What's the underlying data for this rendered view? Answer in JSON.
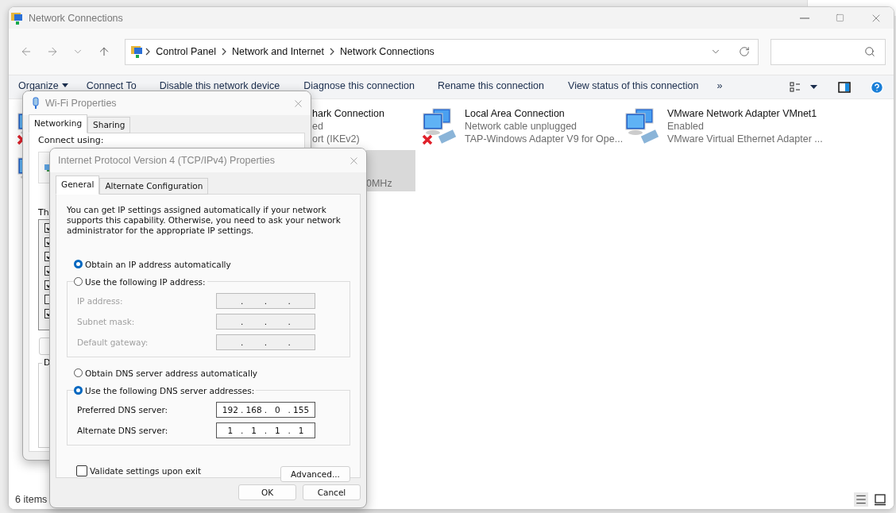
{
  "window": {
    "title": "Network Connections"
  },
  "address_bar": {
    "path": [
      "Control Panel",
      "Network and Internet",
      "Network Connections"
    ]
  },
  "command_bar": {
    "items": [
      {
        "label": "Organize",
        "kind": "menu"
      },
      {
        "label": "Connect To",
        "kind": "plain"
      },
      {
        "label": "Disable this network device",
        "kind": "plain"
      },
      {
        "label": "Diagnose this connection",
        "kind": "plain"
      },
      {
        "label": "Rename this connection",
        "kind": "plain"
      },
      {
        "label": "View status of this connection",
        "kind": "plain"
      }
    ],
    "overflow": "»"
  },
  "edge_icons": [
    {
      "disconnected": true
    },
    {
      "disconnected": false
    }
  ],
  "connections": [
    {
      "kind": "partial",
      "lines": [
        "hark Connection",
        "ed",
        "ort (IKEv2)"
      ],
      "selected": false
    },
    {
      "kind": "partial",
      "lines": [
        "0MHz"
      ],
      "selected": true
    },
    {
      "kind": "full",
      "lines": [
        "Local Area Connection",
        "Network cable unplugged",
        "TAP-Windows Adapter V9 for Ope..."
      ],
      "selected": false,
      "disconnected": true
    },
    {
      "kind": "full",
      "lines": [
        "VMware Network Adapter VMnet1",
        "Enabled",
        "VMware Virtual Ethernet Adapter ..."
      ],
      "selected": false,
      "disconnected": false
    }
  ],
  "wifi_properties": {
    "title": "Wi-Fi Properties",
    "tabs": [
      {
        "label": "Networking",
        "selected": true
      },
      {
        "label": "Sharing",
        "selected": false
      }
    ],
    "connect_label": "Connect using:",
    "list_label": "Th",
    "components": [
      {
        "checked": true
      },
      {
        "checked": true
      },
      {
        "checked": true
      },
      {
        "checked": true
      },
      {
        "checked": true
      },
      {
        "checked": false
      },
      {
        "checked": true
      }
    ],
    "group_label": "D"
  },
  "ipv4_properties": {
    "title": "Internet Protocol Version 4 (TCP/IPv4) Properties",
    "tabs": [
      {
        "label": "General",
        "selected": true
      },
      {
        "label": "Alternate Configuration",
        "selected": false
      }
    ],
    "intro": "You can get IP settings assigned automatically if your network supports this capability. Otherwise, you need to ask your network administrator for the appropriate IP settings.",
    "ip_auto": {
      "label": "Obtain an IP address automatically",
      "selected": true
    },
    "ip_manual": {
      "label": "Use the following IP address:",
      "selected": false
    },
    "ip_fields": [
      {
        "label": "IP address:",
        "disabled": true,
        "segments": [
          {
            "kind": "dot",
            "text": "."
          },
          {
            "kind": "dot",
            "text": "."
          },
          {
            "kind": "dot",
            "text": "."
          }
        ]
      },
      {
        "label": "Subnet mask:",
        "disabled": true,
        "segments": [
          {
            "kind": "dot",
            "text": "."
          },
          {
            "kind": "dot",
            "text": "."
          },
          {
            "kind": "dot",
            "text": "."
          }
        ]
      },
      {
        "label": "Default gateway:",
        "disabled": true,
        "segments": [
          {
            "kind": "dot",
            "text": "."
          },
          {
            "kind": "dot",
            "text": "."
          },
          {
            "kind": "dot",
            "text": "."
          }
        ]
      }
    ],
    "dns_auto": {
      "label": "Obtain DNS server address automatically",
      "selected": false
    },
    "dns_manual": {
      "label": "Use the following DNS server addresses:",
      "selected": true
    },
    "dns_fields": [
      {
        "label": "Preferred DNS server:",
        "disabled": false,
        "segments": [
          {
            "kind": "octet",
            "text": "192"
          },
          {
            "kind": "dot",
            "text": "."
          },
          {
            "kind": "octet",
            "text": "168"
          },
          {
            "kind": "dot",
            "text": "."
          },
          {
            "kind": "octet",
            "text": "0"
          },
          {
            "kind": "dot",
            "text": "."
          },
          {
            "kind": "octet",
            "text": "155"
          }
        ]
      },
      {
        "label": "Alternate DNS server:",
        "disabled": false,
        "segments": [
          {
            "kind": "octet",
            "text": "1"
          },
          {
            "kind": "dot",
            "text": "."
          },
          {
            "kind": "octet",
            "text": "1"
          },
          {
            "kind": "dot",
            "text": "."
          },
          {
            "kind": "octet",
            "text": "1"
          },
          {
            "kind": "dot",
            "text": "."
          },
          {
            "kind": "octet",
            "text": "1"
          }
        ]
      }
    ],
    "validate": {
      "label": "Validate settings upon exit",
      "checked": false
    },
    "advanced_button": "Advanced...",
    "buttons": [
      "OK",
      "Cancel"
    ]
  },
  "status_bar": {
    "count": "6 items"
  }
}
